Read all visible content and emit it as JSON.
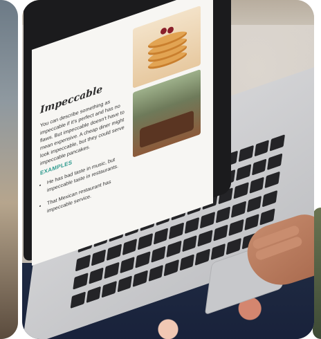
{
  "slide": {
    "title": "Impeccable",
    "description": "You can describe something as impeccable if it's perfect and has no flaws. But impeccable doesn't have to mean expensive. A cheap diner might look impeccable, but they could serve impeccable pancakes.",
    "examples_heading": "EXAMPLES",
    "examples": [
      "He has bad taste in music, but impeccable taste in restaurants.",
      "That Mexican restaurant has impeccable service."
    ]
  },
  "colors": {
    "examples_heading": "#2e9a8e",
    "laptop_bezel": "#1b1b1d",
    "clothing": "#1e2a44"
  }
}
